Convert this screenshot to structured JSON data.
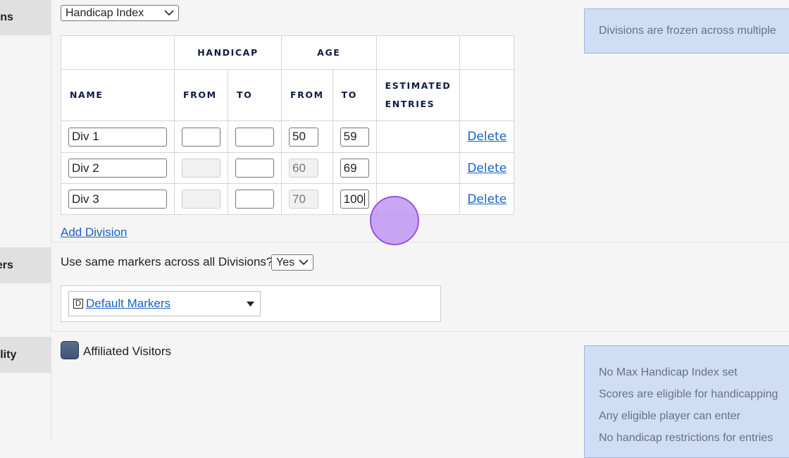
{
  "sections": {
    "divisions_label": "ions",
    "markers_label": "kers",
    "eligibility_label": "bility"
  },
  "divisions": {
    "type_select": "Handicap Index",
    "info_text": "Divisions are frozen across multiple",
    "headers": {
      "handicap": "HANDICAP",
      "age": "AGE",
      "name": "NAME",
      "from": "FROM",
      "to": "TO",
      "age_from": "FROM",
      "age_to": "TO",
      "estimated": "ESTIMATED",
      "entries": "ENTRIES"
    },
    "rows": [
      {
        "name": "Div 1",
        "hcp_from": "",
        "hcp_to": "",
        "age_from": "50",
        "age_to": "59",
        "delete": "Delete"
      },
      {
        "name": "Div 2",
        "hcp_from": "",
        "hcp_to": "",
        "age_from": "60",
        "age_to": "69",
        "delete": "Delete"
      },
      {
        "name": "Div 3",
        "hcp_from": "",
        "hcp_to": "",
        "age_from": "70",
        "age_to": "100",
        "delete": "Delete"
      }
    ],
    "add_division": "Add Division"
  },
  "markers": {
    "question": "Use same markers across all Divisions?",
    "same_markers_value": "Yes",
    "marker_icon_letter": "D",
    "marker_select": "Default Markers"
  },
  "eligibility": {
    "checkbox_label": "Affiliated Visitors",
    "info_lines": [
      "No Max Handicap Index set",
      "Scores are eligible for handicapping",
      "Any eligible player can enter",
      "No handicap restrictions for entries"
    ]
  },
  "colors": {
    "accent_link": "#1762c4",
    "header_text": "#0e1a47",
    "info_bg": "#cfddf5",
    "cursor": "#b98ef2"
  }
}
